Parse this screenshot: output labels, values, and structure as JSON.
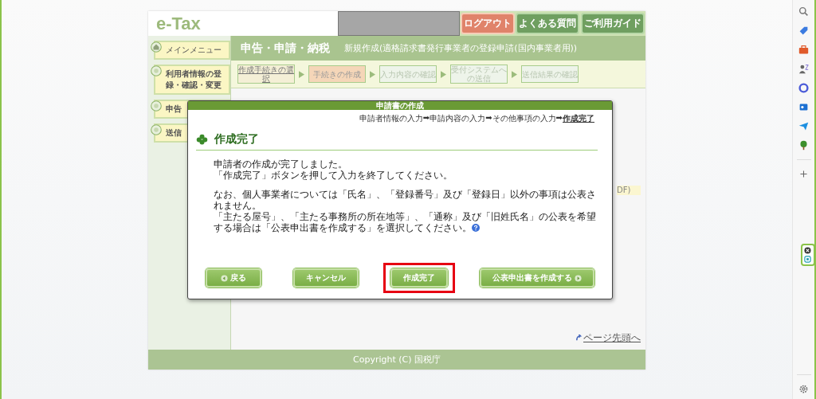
{
  "header": {
    "logo": "e-Tax",
    "buttons": [
      {
        "label": "ログアウト",
        "kind": "logout"
      },
      {
        "label": "よくある質問",
        "kind": "normal"
      },
      {
        "label": "ご利用ガイド",
        "kind": "normal"
      }
    ]
  },
  "sidebar": {
    "items": [
      {
        "label": "メインメニュー",
        "kind": "main"
      },
      {
        "label": "利用者情報の登録・確認・変更",
        "kind": "sub"
      },
      {
        "label": "申告",
        "kind": "sub"
      },
      {
        "label": "送信",
        "kind": "sub"
      }
    ]
  },
  "title_bar": {
    "title": "申告・申請・納税",
    "subtitle": "新規作成(適格請求書発行事業者の登録申請(国内事業者用))"
  },
  "steps": [
    {
      "label": "作成手続きの選択",
      "selected": false,
      "disabled": false
    },
    {
      "label": "手続きの作成",
      "selected": true,
      "disabled": false
    },
    {
      "label": "入力内容の確認",
      "selected": false,
      "disabled": true
    },
    {
      "label": "受付システムへの送信",
      "selected": false,
      "disabled": true
    },
    {
      "label": "送信結果の確認",
      "selected": false,
      "disabled": true
    }
  ],
  "table_header_fragment": "DF)",
  "page_top_link": "ページ先頭へ",
  "footer": "Copyright (C) 国税庁",
  "dialog": {
    "title": "申請書の作成",
    "progress": [
      {
        "label": "申請者情報の入力",
        "selected": false
      },
      {
        "label": "申請内容の入力",
        "selected": false
      },
      {
        "label": "その他事項の入力",
        "selected": false
      },
      {
        "label": "作成完了",
        "selected": true
      }
    ],
    "progress_arrow": "➡",
    "heading": "作成完了",
    "paragraphs": [
      [
        "申請者の作成が完了しました。",
        "「作成完了」ボタンを押して入力を終了してください。"
      ],
      [
        "なお、個人事業者については「氏名」、「登録番号」及び「登録日」以外の事項は公表されません。",
        "「主たる屋号」、「主たる事務所の所在地等」、「通称」及び「旧姓氏名」の公表を希望する場合は「公表申出書を作成する」を選択してください。"
      ]
    ],
    "buttons": [
      {
        "label": "戻る",
        "kind": "back",
        "highlighted": false
      },
      {
        "label": "キャンセル",
        "kind": "plain",
        "highlighted": false
      },
      {
        "label": "作成完了",
        "kind": "plain",
        "highlighted": true
      },
      {
        "label": "公表申出書を作成する",
        "kind": "forward",
        "highlighted": false
      }
    ]
  }
}
